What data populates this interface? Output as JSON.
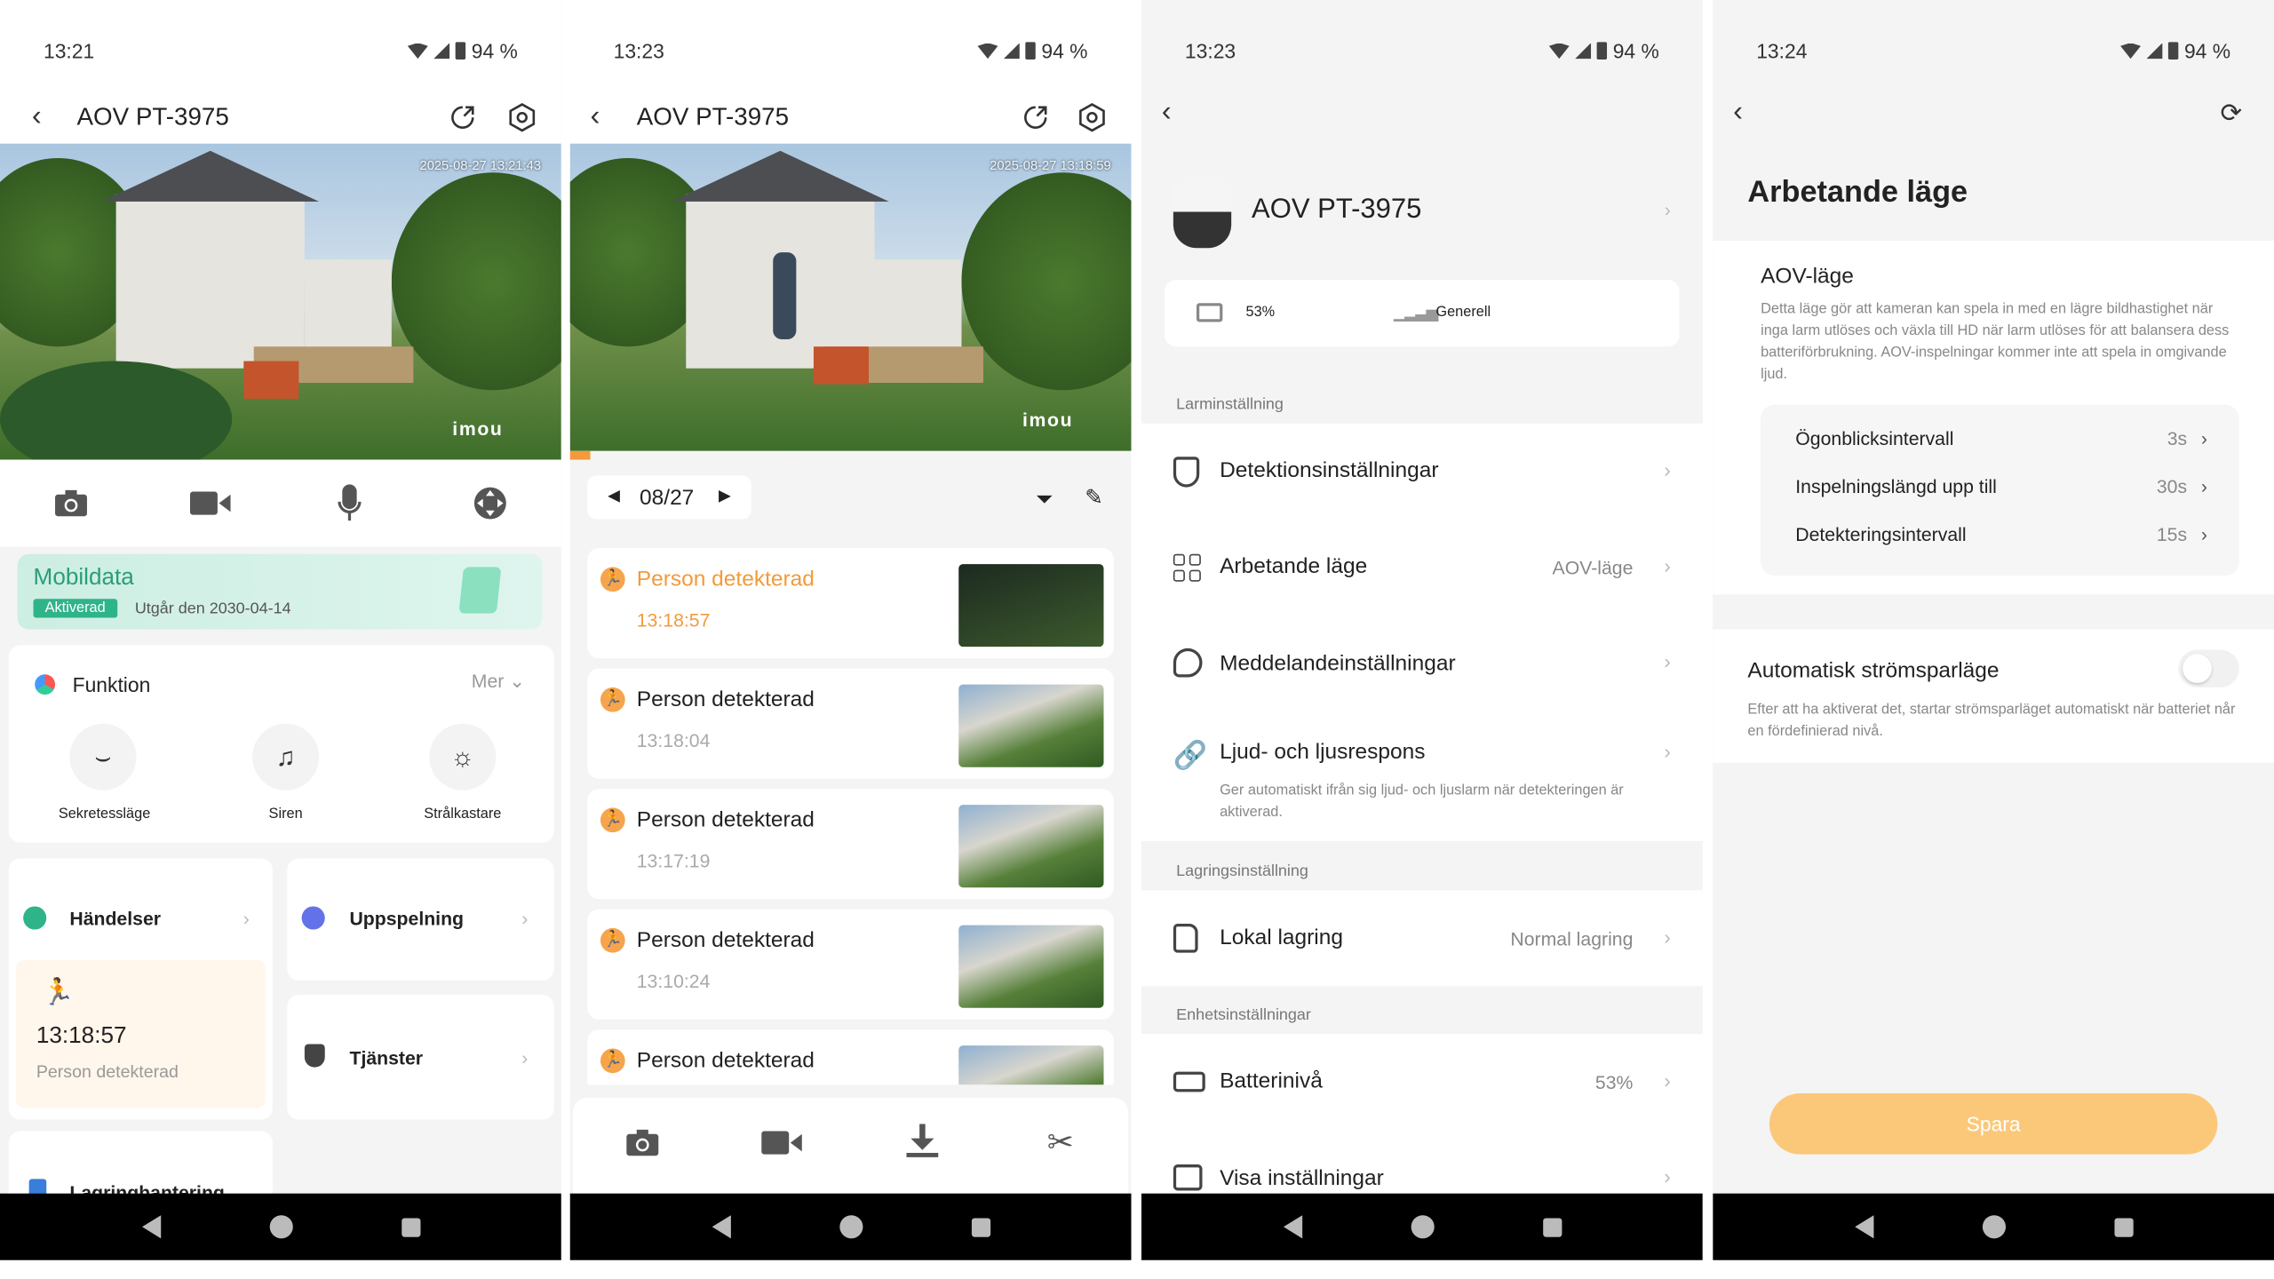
{
  "status": {
    "s1_time": "13:21",
    "s2_time": "13:23",
    "s3_time": "13:23",
    "s4_time": "13:24",
    "battery": "94 %"
  },
  "device": {
    "name": "AOV PT-3975",
    "timestamp1": "2025-08-27 13:21:43",
    "timestamp2": "2025-08-27 13:18:59",
    "brand": "imou"
  },
  "s1": {
    "mobiledata_title": "Mobildata",
    "mobiledata_badge": "Aktiverad",
    "mobiledata_expiry": "Utgår den 2030-04-14",
    "function_title": "Funktion",
    "more": "Mer",
    "functions": [
      "Sekretessläge",
      "Siren",
      "Strålkastare"
    ],
    "events_title": "Händelser",
    "event_time": "13:18:57",
    "event_label": "Person detekterad",
    "playback_title": "Uppspelning",
    "services_title": "Tjänster",
    "storage_title": "Lagringhantering"
  },
  "s2": {
    "date": "08/27",
    "events": [
      {
        "label": "Person detekterad",
        "time": "13:18:57",
        "active": true
      },
      {
        "label": "Person detekterad",
        "time": "13:18:04",
        "active": false
      },
      {
        "label": "Person detekterad",
        "time": "13:17:19",
        "active": false
      },
      {
        "label": "Person detekterad",
        "time": "13:10:24",
        "active": false
      },
      {
        "label": "Person detekterad",
        "time": "",
        "active": false
      }
    ]
  },
  "s3": {
    "battery_pct": "53%",
    "signal_label": "Generell",
    "section_alarm": "Larminställning",
    "detection": "Detektionsinställningar",
    "workmode": "Arbetande läge",
    "workmode_val": "AOV-läge",
    "notifications": "Meddelandeinställningar",
    "soundlight": "Ljud- och ljusrespons",
    "soundlight_desc": "Ger automatiskt ifrån sig ljud- och ljuslarm när detekteringen är aktiverad.",
    "section_storage": "Lagringsinställning",
    "local_storage": "Lokal lagring",
    "local_storage_val": "Normal lagring",
    "section_device": "Enhetsinställningar",
    "battery_level": "Batterinivå",
    "battery_level_val": "53%",
    "display_settings": "Visa inställningar"
  },
  "s4": {
    "title": "Arbetande läge",
    "aov_title": "AOV-läge",
    "aov_desc": "Detta läge gör att kameran kan spela in med en lägre bildhastighet när inga larm utlöses och växla till HD när larm utlöses för att balansera dess batteriförbrukning. AOV-inspelningar kommer inte att spela in omgivande ljud.",
    "rows": [
      {
        "label": "Ögonblicksintervall",
        "value": "3s"
      },
      {
        "label": "Inspelningslängd upp till",
        "value": "30s"
      },
      {
        "label": "Detekteringsintervall",
        "value": "15s"
      }
    ],
    "auto_title": "Automatisk strömsparläge",
    "auto_desc": "Efter att ha aktiverat det, startar strömsparläget automatiskt när batteriet når en fördefinierad nivå.",
    "save": "Spara"
  }
}
